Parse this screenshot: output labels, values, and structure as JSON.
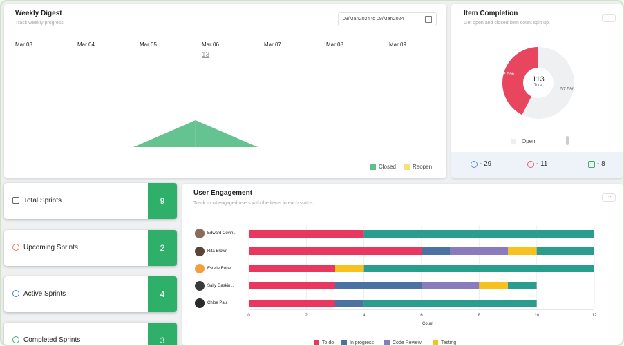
{
  "weekly_digest": {
    "title": "Weekly Digest",
    "subtitle": "Track weekly progress",
    "date_range": "03/Mar/2024 to 09/Mar/2024",
    "days": [
      "Mar 03",
      "Mar 04",
      "Mar 05",
      "Mar 06",
      "Mar 07",
      "Mar 08",
      "Mar 09"
    ],
    "highlight_count": "13",
    "legend": [
      {
        "label": "Closed",
        "color": "#5cc08a"
      },
      {
        "label": "Reopen",
        "color": "#f6e07a"
      }
    ]
  },
  "item_completion": {
    "title": "Item Completion",
    "subtitle": "Get open and closed item count split up.",
    "more": "···",
    "total_value": "113",
    "total_label": "Total",
    "pct_closed": "42.5%",
    "pct_open": "57.5%",
    "closed_fraction": 0.425,
    "legend_open": "Open",
    "stats": [
      {
        "icon": "check-circle-icon",
        "value": "- 29",
        "color": "#5b8fd6"
      },
      {
        "icon": "bug-icon",
        "value": "- 11",
        "color": "#e4566b"
      },
      {
        "icon": "task-icon",
        "value": "- 8",
        "color": "#3fae6a"
      }
    ]
  },
  "sprints": [
    {
      "label": "Total Sprints",
      "count": "9",
      "icon": "sprint-total-icon",
      "color": "#666666"
    },
    {
      "label": "Upcoming Sprints",
      "count": "2",
      "icon": "clock-icon",
      "color": "#f07c5a"
    },
    {
      "label": "Active Sprints",
      "count": "4",
      "icon": "target-icon",
      "color": "#3b82d6"
    },
    {
      "label": "Completed Sprints",
      "count": "3",
      "icon": "check-circle-icon",
      "color": "#3fae6a"
    }
  ],
  "user_engagement": {
    "title": "User Engagement",
    "subtitle": "Track most engaged users with the items in each status.",
    "more": "···",
    "xlabel": "Count",
    "users": [
      "Edward Covin...",
      "Rita Brown",
      "Estelle Robe...",
      "Sally Gaskin...",
      "Chloe Paul"
    ],
    "legend": [
      {
        "label": "To do",
        "color": "#e8385f"
      },
      {
        "label": "In progress",
        "color": "#4a73a3"
      },
      {
        "label": "Code Review",
        "color": "#8a7bbd"
      },
      {
        "label": "Testing",
        "color": "#f7c21d"
      }
    ]
  },
  "chart_data": [
    {
      "type": "area",
      "title": "Weekly Digest",
      "categories": [
        "Mar 03",
        "Mar 04",
        "Mar 05",
        "Mar 06",
        "Mar 07",
        "Mar 08",
        "Mar 09"
      ],
      "series": [
        {
          "name": "Closed",
          "values": [
            0,
            0,
            0,
            13,
            0,
            0,
            0
          ]
        },
        {
          "name": "Reopen",
          "values": [
            0,
            0,
            0,
            0,
            0,
            0,
            0
          ]
        }
      ]
    },
    {
      "type": "pie",
      "title": "Item Completion",
      "labels": [
        "Closed",
        "Open"
      ],
      "values": [
        42.5,
        57.5
      ],
      "colors": [
        "#e8455f",
        "#f0f1f2"
      ],
      "total": 113
    },
    {
      "type": "bar",
      "orientation": "horizontal",
      "stacked": true,
      "title": "User Engagement",
      "xlabel": "Count",
      "xlim": [
        0,
        12
      ],
      "x_ticks": [
        0,
        2,
        4,
        6,
        8,
        10,
        12
      ],
      "categories": [
        "Edward Covin...",
        "Rita Brown",
        "Estelle Robe...",
        "Sally Gaskin...",
        "Chloe Paul"
      ],
      "series": [
        {
          "name": "To do",
          "color": "#e8385f",
          "values": [
            4,
            6,
            3,
            3,
            3
          ]
        },
        {
          "name": "In progress",
          "color": "#4a73a3",
          "values": [
            0,
            1,
            0,
            3,
            1
          ]
        },
        {
          "name": "Code Review",
          "color": "#8a7bbd",
          "values": [
            0,
            2,
            0,
            2,
            0
          ]
        },
        {
          "name": "Testing",
          "color": "#f7c21d",
          "values": [
            0,
            1,
            1,
            1,
            0
          ]
        },
        {
          "color": "#2a9d8f",
          "values": [
            8,
            2,
            8,
            1,
            6
          ]
        }
      ]
    }
  ]
}
